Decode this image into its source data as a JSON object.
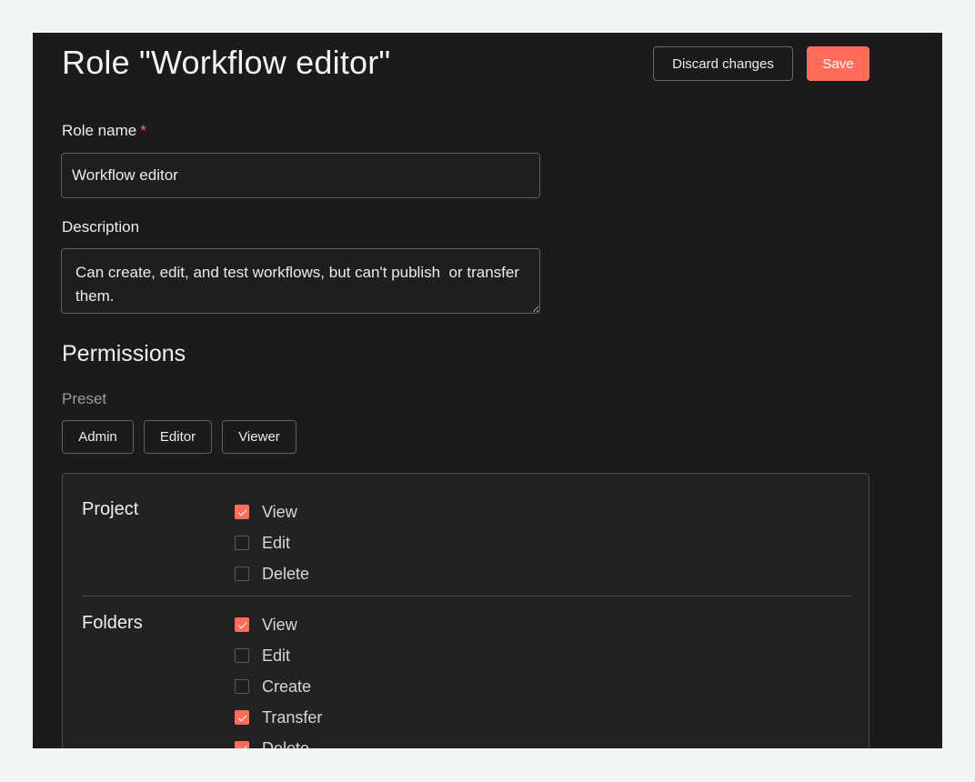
{
  "header": {
    "title": "Role \"Workflow editor\"",
    "discard_label": "Discard changes",
    "save_label": "Save"
  },
  "form": {
    "role_name_label": "Role name",
    "required_marker": "*",
    "role_name_value": "Workflow editor",
    "description_label": "Description",
    "description_value": "Can create, edit, and test workflows, but can't publish  or transfer them."
  },
  "permissions": {
    "title": "Permissions",
    "preset_label": "Preset",
    "presets": [
      "Admin",
      "Editor",
      "Viewer"
    ],
    "groups": [
      {
        "name": "Project",
        "items": [
          {
            "label": "View",
            "checked": true
          },
          {
            "label": "Edit",
            "checked": false
          },
          {
            "label": "Delete",
            "checked": false
          }
        ]
      },
      {
        "name": "Folders",
        "items": [
          {
            "label": "View",
            "checked": true
          },
          {
            "label": "Edit",
            "checked": false
          },
          {
            "label": "Create",
            "checked": false
          },
          {
            "label": "Transfer",
            "checked": true
          },
          {
            "label": "Delete",
            "checked": true
          }
        ]
      }
    ]
  },
  "colors": {
    "accent": "#ff6d5a",
    "panel_bg": "#1b1b1b",
    "page_bg": "#f0f5f1"
  }
}
